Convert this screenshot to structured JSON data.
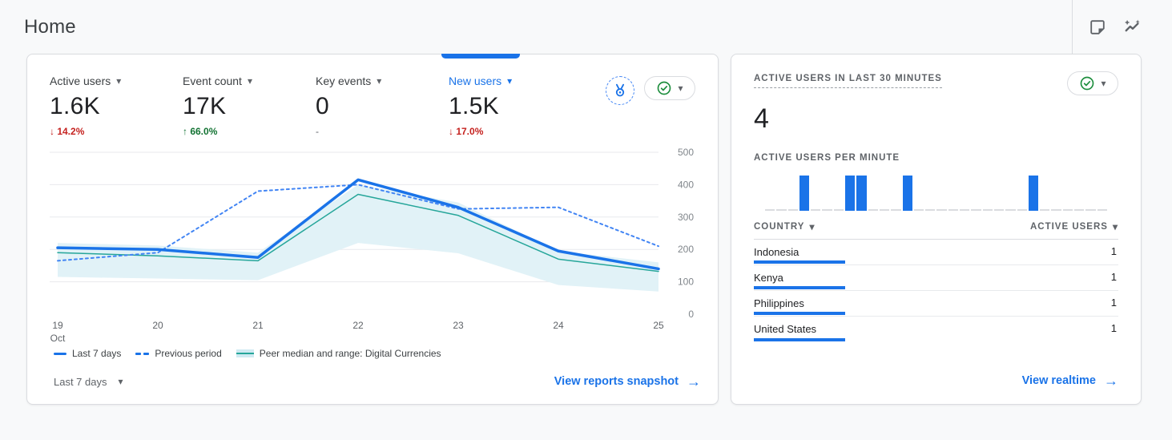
{
  "icons": {
    "caret": "▾",
    "arrow_right": "→"
  },
  "colors": {
    "accent_blue": "#1a73e8",
    "previous_period_blue": "#4285f4",
    "peer_teal": "#26a69a",
    "peer_band": "#e1f2f7",
    "negative_red": "#c5221f",
    "positive_green": "#137333",
    "grid": "#e8eaed",
    "text_secondary": "#5f6368"
  },
  "header": {
    "title": "Home"
  },
  "overview_card": {
    "metrics": [
      {
        "label": "Active users",
        "value": "1.6K",
        "delta": "↓ 14.2%",
        "trend": "down"
      },
      {
        "label": "Event count",
        "value": "17K",
        "delta": "↑ 66.0%",
        "trend": "up"
      },
      {
        "label": "Key events",
        "value": "0",
        "delta": "-",
        "trend": "none"
      },
      {
        "label": "New users",
        "value": "1.5K",
        "delta": "↓ 17.0%",
        "trend": "down",
        "selected": true
      }
    ],
    "chart_data": {
      "type": "line",
      "x": [
        "19",
        "20",
        "21",
        "22",
        "23",
        "24",
        "25"
      ],
      "x_month_label": "Oct",
      "ylim": [
        0,
        500
      ],
      "yticks": [
        0,
        100,
        200,
        300,
        400,
        500
      ],
      "grid": true,
      "legend_position": "bottom",
      "series": [
        {
          "name": "Last 7 days",
          "style": "solid",
          "color": "#1a73e8",
          "width": 3.5,
          "values": [
            205,
            200,
            175,
            415,
            330,
            195,
            140
          ]
        },
        {
          "name": "Previous period",
          "style": "dashed",
          "color": "#4285f4",
          "width": 2,
          "values": [
            165,
            190,
            380,
            400,
            325,
            330,
            210
          ]
        },
        {
          "name": "Peer median and range: Digital Currencies",
          "style": "solid",
          "color": "#26a69a",
          "width": 1.5,
          "values": [
            190,
            180,
            165,
            370,
            305,
            170,
            132
          ],
          "range_upper": [
            220,
            212,
            190,
            400,
            345,
            195,
            160
          ],
          "range_lower": [
            115,
            110,
            105,
            220,
            188,
            90,
            70
          ],
          "range_fill": "#e1f2f7"
        }
      ]
    },
    "legend": [
      {
        "label": "Last 7 days"
      },
      {
        "label": "Previous period"
      },
      {
        "label": "Peer median and range: Digital Currencies"
      }
    ],
    "footer": {
      "range_label": "Last 7 days",
      "link_label": "View reports snapshot"
    }
  },
  "realtime_card": {
    "title": "ACTIVE USERS IN LAST 30 MINUTES",
    "value": "4",
    "per_minute_title": "ACTIVE USERS PER MINUTE",
    "chart_data": {
      "type": "bar",
      "x_slots": 30,
      "values": [
        0,
        0,
        0,
        1,
        0,
        0,
        0,
        1,
        1,
        0,
        0,
        0,
        1,
        0,
        0,
        0,
        0,
        0,
        0,
        0,
        0,
        0,
        0,
        1,
        0,
        0,
        0,
        0,
        0,
        0
      ],
      "bar_color": "#1a73e8"
    },
    "table": {
      "columns": [
        {
          "label": "COUNTRY"
        },
        {
          "label": "ACTIVE USERS"
        }
      ],
      "rows": [
        {
          "country": "Indonesia",
          "value": "1",
          "bar_pct": 25
        },
        {
          "country": "Kenya",
          "value": "1",
          "bar_pct": 25
        },
        {
          "country": "Philippines",
          "value": "1",
          "bar_pct": 25
        },
        {
          "country": "United States",
          "value": "1",
          "bar_pct": 25
        }
      ]
    },
    "footer": {
      "link_label": "View realtime"
    }
  }
}
